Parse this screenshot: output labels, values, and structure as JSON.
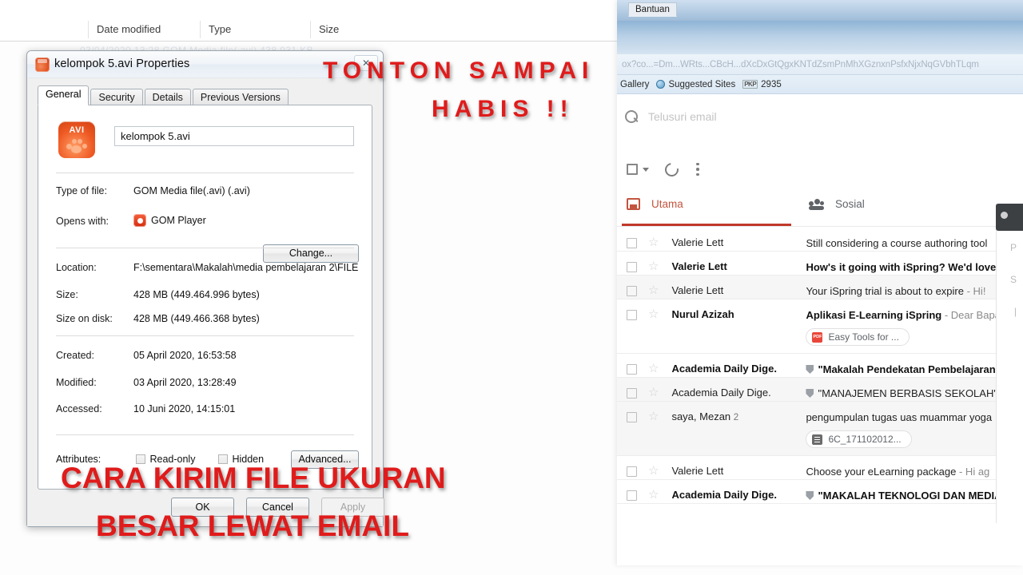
{
  "explorer": {
    "columns": [
      "Date modified",
      "Type",
      "Size"
    ],
    "ghost_row": "03/04/2020 13:28            GOM Media file(.avi)            438.931 KB"
  },
  "dialog": {
    "title": "kelompok 5.avi Properties",
    "close_label": "✕",
    "tabs": [
      {
        "label": "General",
        "active": true
      },
      {
        "label": "Security",
        "active": false
      },
      {
        "label": "Details",
        "active": false
      },
      {
        "label": "Previous Versions",
        "active": false
      }
    ],
    "file_icon_label": "AVI",
    "filename": "kelompok 5.avi",
    "fields": [
      {
        "key": "Type of file:",
        "value": "GOM Media file(.avi) (.avi)"
      },
      {
        "key": "Location:",
        "value": "F:\\sementara\\Makalah\\media pembelajaran 2\\FILE"
      },
      {
        "key": "Size:",
        "value": "428 MB (449.464.996 bytes)"
      },
      {
        "key": "Size on disk:",
        "value": "428 MB (449.466.368 bytes)"
      },
      {
        "key": "Created:",
        "value": "05 April 2020, 16:53:58"
      },
      {
        "key": "Modified:",
        "value": "03 April 2020, 13:28:49"
      },
      {
        "key": "Accessed:",
        "value": "10 Juni 2020, 14:15:01"
      }
    ],
    "opens_with_key": "Opens with:",
    "opens_with_value": "GOM Player",
    "change_button": "Change...",
    "attributes_label": "Attributes:",
    "attr_readonly": "Read-only",
    "attr_hidden": "Hidden",
    "advanced_button": "Advanced...",
    "ok_button": "OK",
    "cancel_button": "Cancel",
    "apply_button": "Apply"
  },
  "browser": {
    "menu_item": "Bantuan",
    "url": "ox?co...=Dm...WRts...CBcH...dXcDxGtQgxKNTdZsmPnMhXGznxnPsfxNjxNqGVbhTLqm",
    "bookmarks": [
      {
        "label": "Gallery",
        "icon": "none"
      },
      {
        "label": "Suggested Sites",
        "icon": "globe-icon"
      },
      {
        "label": "2935",
        "icon": "pkp-icon"
      }
    ]
  },
  "gmail": {
    "search_placeholder": "Telusuri email",
    "toolbar": {
      "select_all": "select-all-checkbox",
      "refresh": "refresh-icon",
      "more": "more-options-icon"
    },
    "tabs": [
      {
        "label": "Utama",
        "active": true
      },
      {
        "label": "Sosial",
        "active": false
      }
    ],
    "messages": [
      {
        "sender": "Valerie Lett",
        "count": "",
        "unread": false,
        "subject": "Still considering a course authoring tool",
        "snippet": "",
        "has_dock_icon": false,
        "attachment": null
      },
      {
        "sender": "Valerie Lett",
        "count": "",
        "unread": true,
        "subject": "How's it going with iSpring? We'd love y",
        "snippet": "",
        "has_dock_icon": false,
        "attachment": null
      },
      {
        "sender": "Valerie Lett",
        "count": "",
        "unread": false,
        "subject": "Your iSpring trial is about to expire",
        "snippet": " - Hi!",
        "has_dock_icon": false,
        "attachment": null
      },
      {
        "sender": "Nurul Azizah",
        "count": "",
        "unread": true,
        "subject": "Aplikasi E-Learning iSpring",
        "snippet": " - Dear Bapak",
        "has_dock_icon": false,
        "attachment": {
          "type": "pdf",
          "label": "Easy Tools for ...",
          "icon_text": "PDF"
        }
      },
      {
        "sender": "Academia Daily Dige.",
        "count": "",
        "unread": true,
        "subject": "\"Makalah Pendekatan Pembelajaran\"",
        "snippet": "",
        "has_dock_icon": true,
        "attachment": null
      },
      {
        "sender": "Academia Daily Dige.",
        "count": "",
        "unread": false,
        "subject": "\"MANAJEMEN BERBASIS SEKOLAH\"",
        "snippet": "",
        "has_dock_icon": true,
        "attachment": null
      },
      {
        "sender": "saya, Mezan",
        "count": "2",
        "unread": false,
        "subject": "pengumpulan tugas uas muammar yoga",
        "snippet": "",
        "has_dock_icon": false,
        "attachment": {
          "type": "doc",
          "label": "6C_171102012...",
          "icon_text": ""
        }
      },
      {
        "sender": "Valerie Lett",
        "count": "",
        "unread": false,
        "subject": "Choose your eLearning package",
        "snippet": " - Hi ag",
        "has_dock_icon": false,
        "attachment": null
      },
      {
        "sender": "Academia Daily Dige.",
        "count": "",
        "unread": true,
        "subject": "\"MAKALAH TEKNOLOGI DAN MEDIA",
        "snippet": "",
        "has_dock_icon": true,
        "attachment": null
      }
    ],
    "side_panel_letters": [
      "P",
      "S",
      "|"
    ]
  },
  "overlay": {
    "top_line1": "TONTON SAMPAI",
    "top_line2": "HABIS !!",
    "bottom_line1": "CARA KIRIM FILE UKURAN",
    "bottom_line2": "BESAR LEWAT EMAIL",
    "color": "#e01b1b"
  }
}
